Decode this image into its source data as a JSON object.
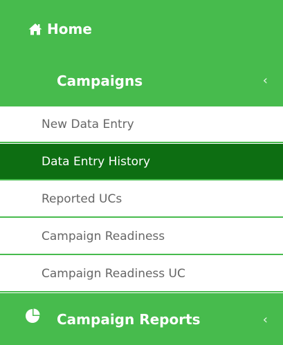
{
  "sidebar": {
    "home": {
      "icon": "home-icon",
      "label": "Home"
    },
    "campaigns": {
      "label": "Campaigns",
      "chevron": "‹",
      "items": [
        {
          "label": "New Data Entry",
          "active": false
        },
        {
          "label": "Data Entry History",
          "active": true
        },
        {
          "label": "Reported UCs",
          "active": false
        },
        {
          "label": "Campaign Readiness",
          "active": false
        },
        {
          "label": "Campaign Readiness UC",
          "active": false
        }
      ]
    },
    "campaign_reports": {
      "icon": "pie-chart-icon",
      "label": "Campaign Reports",
      "chevron": "‹"
    }
  },
  "colors": {
    "brand_green": "#47bb4d",
    "active_green": "#0d6e12",
    "text_gray": "#666666",
    "white": "#ffffff"
  }
}
